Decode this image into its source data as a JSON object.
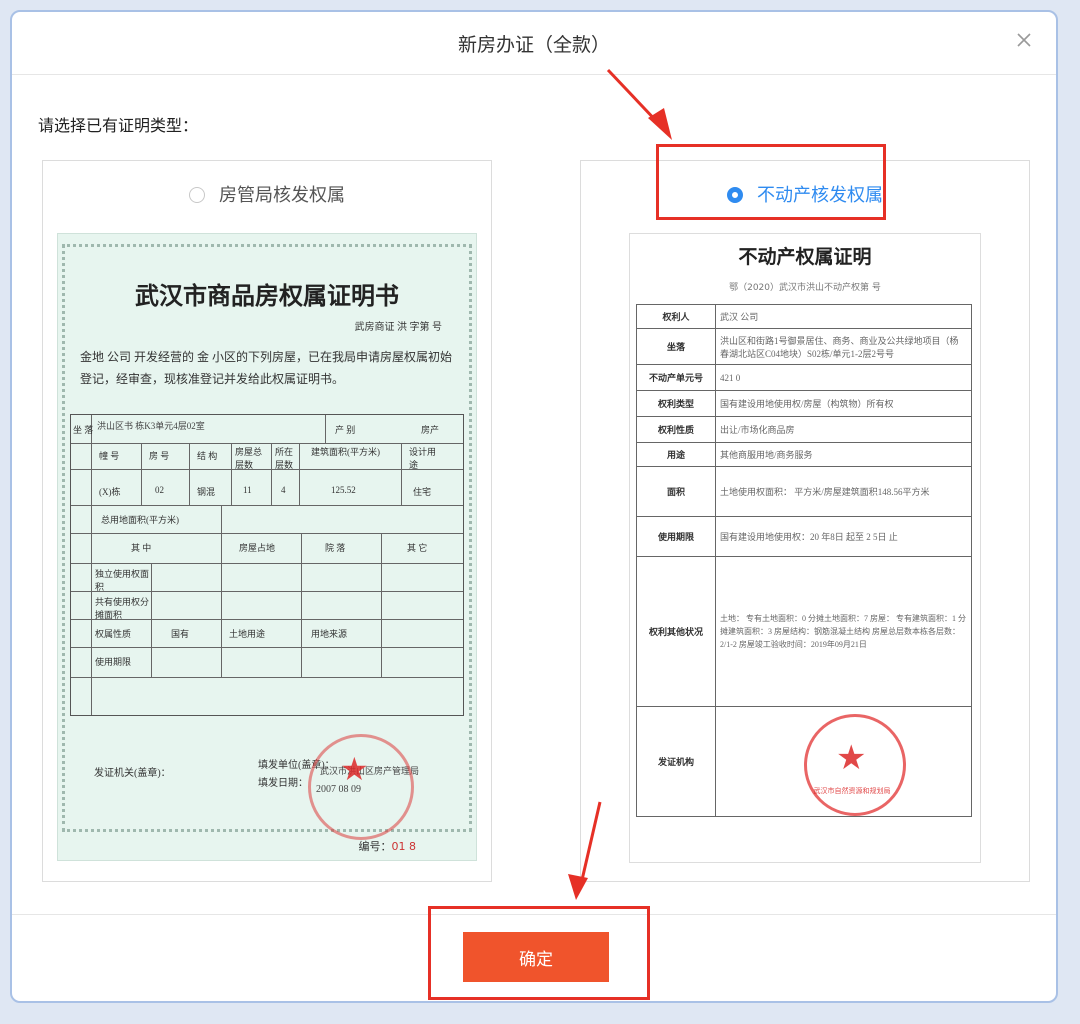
{
  "dialog": {
    "title": "新房办证（全款）",
    "prompt": "请选择已有证明类型：",
    "confirm_label": "确定",
    "options": [
      {
        "label": "房管局核发权属",
        "selected": false
      },
      {
        "label": "不动产核发权属",
        "selected": true
      }
    ]
  },
  "old_certificate": {
    "title": "武汉市商品房权属证明书",
    "sub": "武房商证 洪 字第        号",
    "para": "金地      公司 开发经营的 金          小区的下列房屋，已在我局申请房屋权属初始登记，经审查，现核准登记并发给此权属证明书。",
    "address_label": "坐 落",
    "address_value": "洪山区书 栋K3单元4层02室",
    "category_label": "产 别",
    "category_value": "房产",
    "house_headers": [
      "幢 号",
      "房 号",
      "结 构",
      "房屋总层数",
      "所在层数",
      "建筑面积(平方米)",
      "设计用途"
    ],
    "house_values": [
      "(X)栋",
      "02",
      "钢混",
      "11",
      "4",
      "125.52",
      "住宅"
    ],
    "land_total": "总用地面积(平方米)",
    "land_among": "其 中",
    "land_cols": [
      "房屋占地",
      "院 落",
      "其 它"
    ],
    "land_rows": [
      "独立使用权面积",
      "共有使用权分摊面积",
      "权属性质",
      "使用期限"
    ],
    "land_nature": "国有",
    "land_use_label": "土地用途",
    "land_source_label": "用地来源",
    "issuer_label": "发证机关(盖章)：",
    "fill_label": "填发单位(盖章)：",
    "fill_date_label": "填发日期：",
    "fill_org": "武汉市洪山区房产管理局",
    "fill_date": "2007  08  09",
    "serial_label": "编号：",
    "serial_value": "01        8"
  },
  "new_certificate": {
    "title": "不动产权属证明",
    "sub": "鄂（2020）武汉市洪山不动产权第        号",
    "rows": [
      {
        "k": "权利人",
        "v": "武汉          公司"
      },
      {
        "k": "坐落",
        "v": "洪山区和街路1号御景居住、商务、商业及公共绿地项目（杨春湖北站区C04地块）S02栋/单元1-2层2号号"
      },
      {
        "k": "不动产单元号",
        "v": "421                    0"
      },
      {
        "k": "权利类型",
        "v": "国有建设用地使用权/房屋（构筑物）所有权"
      },
      {
        "k": "权利性质",
        "v": "出让/市场化商品房"
      },
      {
        "k": "用途",
        "v": "其他商服用地/商务服务"
      },
      {
        "k": "面积",
        "v": "土地使用权面积：        平方米/房屋建筑面积148.56平方米"
      },
      {
        "k": "使用期限",
        "v": "国有建设用地使用权：20    年8日 起至 2        5日 止"
      },
      {
        "k": "权利其他状况",
        "v": "土地：  专有土地面积：0  分摊土地面积：7  房屋：  专有建筑面积：1  分摊建筑面积：3  房屋结构：钢筋混凝土结构  房屋总层数本栋各层数：2/1-2  房屋竣工验收时间：2019年09月21日"
      },
      {
        "k": "发证机构",
        "v": ""
      }
    ],
    "seal_text": "武汉市自然资源和规划局"
  }
}
